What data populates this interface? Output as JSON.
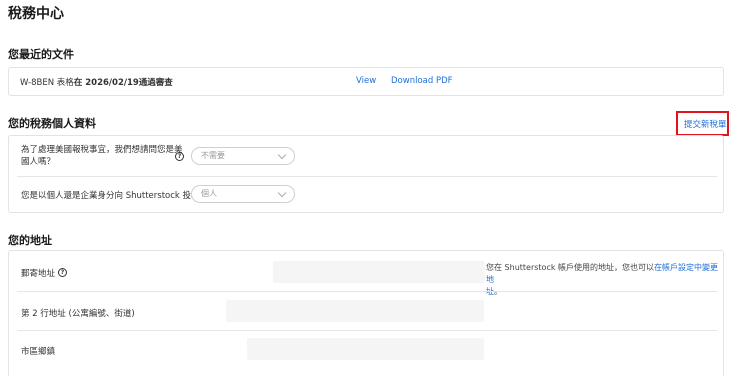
{
  "page": {
    "title": "稅務中心"
  },
  "recent_docs": {
    "title": "您最近的文件",
    "doc_prefix": "W-8BEN 表格",
    "doc_suffix": "在 2026/02/19通過審查",
    "view_label": "View",
    "download_label": "Download PDF"
  },
  "tax_profile": {
    "title": "您的稅務個人資料",
    "submit_new_label": "提交新稅單",
    "q1_line1": "為了處理美國報稅事宜，我們想請問您是美",
    "q1_line2": "國人嗎？",
    "q1_value": "不需要",
    "q2_label": "您是以個人還是企業身分向 Shutterstock 投稿？",
    "q2_value": "個人"
  },
  "address": {
    "title": "您的地址",
    "mailing_label": "郵寄地址",
    "note_prefix": "您在 Shutterstock 帳戶使用的地址，您也可以",
    "note_link_line1": "在帳戶設定中變更地",
    "note_link_line2": "址",
    "note_suffix": "。",
    "line2_label": "第 2 行地址 (公寓編號、街道)",
    "city_label": "市區鄉鎮"
  }
}
